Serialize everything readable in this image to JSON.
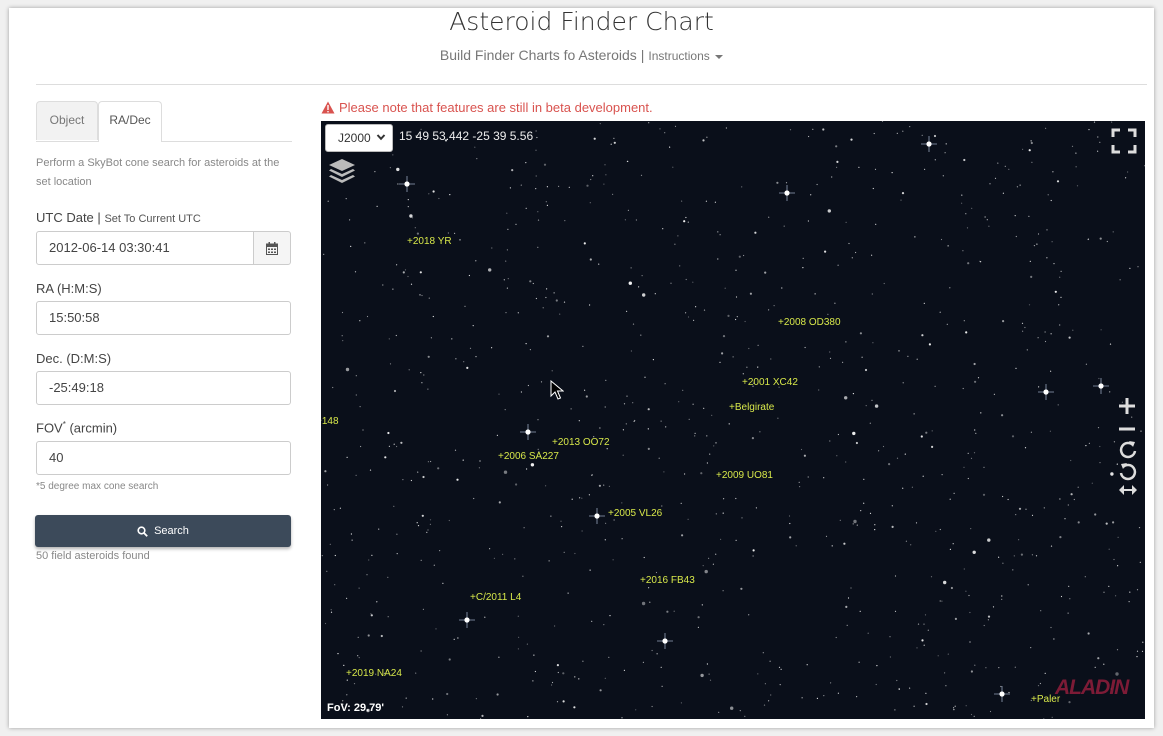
{
  "header": {
    "title": "Asteroid Finder Chart",
    "subtitle": "Build Finder Charts fo Asteroids",
    "separator": "|",
    "instructions_label": "Instructions"
  },
  "tabs": [
    {
      "label": "Object",
      "active": false
    },
    {
      "label": "RA/Dec",
      "active": true
    }
  ],
  "form": {
    "description": "Perform a SkyBot cone search for asteroids at the set location",
    "utc_label": "UTC Date",
    "utc_separator": "|",
    "utc_set_current": "Set To Current UTC",
    "utc_value": "2012-06-14 03:30:41",
    "ra_label": "RA (H:M:S)",
    "ra_value": "15:50:58",
    "dec_label": "Dec. (D:M:S)",
    "dec_value": "-25:49:18",
    "fov_label": "FOV",
    "fov_sup": "*",
    "fov_unit": " (arcmin)",
    "fov_value": "40",
    "fov_help": "*5 degree max cone search",
    "search_label": "Search",
    "result_text": "50 field asteroids found"
  },
  "viewer": {
    "warning": "Please note that features are still in beta development.",
    "frame": "J2000",
    "coordinates": "15 49 53.442 -25 39 5.56",
    "fov": "FoV: 29.79'",
    "logo": "ALADIN",
    "asteroids": [
      "2018 YR",
      "2008 OD380",
      "2001 XC42",
      "Belgirate",
      "148",
      "2013 OO72",
      "2006 SA227",
      "2009 UO81",
      "2005 VL26",
      "2016 FB43",
      "C/2011 L4",
      "2019 NA24",
      "Paler"
    ]
  },
  "colors": {
    "warning": "#d9534f",
    "button": "#3c4a5a",
    "asteroid_label": "#d8e84a",
    "sky": "#0a0f1a"
  }
}
